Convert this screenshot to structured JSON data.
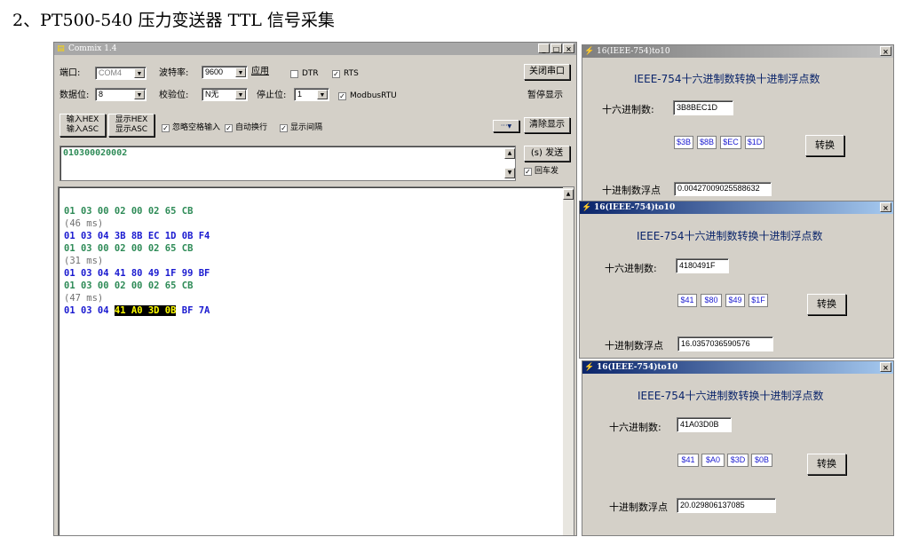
{
  "heading": "2、PT500-540 压力变送器 TTL 信号采集",
  "commix": {
    "title": "Commix 1.4",
    "controls": {
      "minimize": "_",
      "maximize": "□",
      "close": "×"
    },
    "port_label": "端口:",
    "port_value": "COM4",
    "baud_label": "波特率:",
    "baud_value": "9600",
    "apply_button": "应用",
    "dtr_label": "DTR",
    "rts_label": "RTS",
    "close_port_button": "关闭串口",
    "databits_label": "数据位:",
    "databits_value": "8",
    "parity_label": "校验位:",
    "parity_value": "N无",
    "stopbits_label": "停止位:",
    "stopbits_value": "1",
    "modbus_label": "ModbusRTU",
    "pause_display_button": "暂停显示",
    "input_hex_button": "输入HEX",
    "input_asc_button": "输入ASC",
    "display_hex_button": "显示HEX",
    "display_asc_button": "显示ASC",
    "ignore_space_label": "忽略空格输入",
    "auto_newline_label": "自动换行",
    "show_interval_label": "显示间隔",
    "more_button": "···",
    "clear_display_button": "清除显示",
    "command_text": "010300020002",
    "send_button": "(s) 发送",
    "return_send_label": "回车发",
    "terminal_lines": [
      {
        "text": "01 03 00 02 00 02 65 CB",
        "color": "green"
      },
      {
        "text": "(46 ms)",
        "color": "grey"
      },
      {
        "text": "01 03 04 3B 8B EC 1D 0B F4",
        "color": "blue"
      },
      {
        "text": "01 03 00 02 00 02 65 CB",
        "color": "green"
      },
      {
        "text": "(31 ms)",
        "color": "grey"
      },
      {
        "text": "01 03 04 41 80 49 1F 99 BF",
        "color": "blue"
      },
      {
        "text": "01 03 00 02 00 02 65 CB",
        "color": "green"
      },
      {
        "text": "(47 ms)",
        "color": "grey"
      },
      {
        "text_pre": "01 03 04 ",
        "text_hl": "41 A0 3D 0B",
        "text_post": " BF 7A",
        "color": "blue"
      }
    ]
  },
  "converters": [
    {
      "title": "16(IEEE-754)to10",
      "heading": "IEEE-754十六进制数转换十进制浮点数",
      "hex_label": "十六进制数:",
      "hex_value": "3B8BEC1D",
      "bytes": [
        "$3B",
        "$8B",
        "$EC",
        "$1D"
      ],
      "convert_button": "转换",
      "float_label": "十进制数浮点",
      "float_value": "0.00427009025588632"
    },
    {
      "title": "16(IEEE-754)to10",
      "heading": "IEEE-754十六进制数转换十进制浮点数",
      "hex_label": "十六进制数:",
      "hex_value": "4180491F",
      "bytes": [
        "$41",
        "$80",
        "$49",
        "$1F"
      ],
      "convert_button": "转换",
      "float_label": "十进制数浮点",
      "float_value": "16.0357036590576"
    },
    {
      "title": "16(IEEE-754)to10",
      "heading": "IEEE-754十六进制数转换十进制浮点数",
      "hex_label": "十六进制数:",
      "hex_value": "41A03D0B",
      "bytes": [
        "$41",
        "$A0",
        "$3D",
        "$0B"
      ],
      "convert_button": "转换",
      "float_label": "十进制数浮点",
      "float_value": "20.029806137085"
    }
  ],
  "colors": {
    "green_text": "#2e8b57",
    "blue_text": "#1a1ad0",
    "highlight_bg": "#000000",
    "highlight_fg": "#ffff00",
    "window_bg": "#d4d0c8"
  }
}
